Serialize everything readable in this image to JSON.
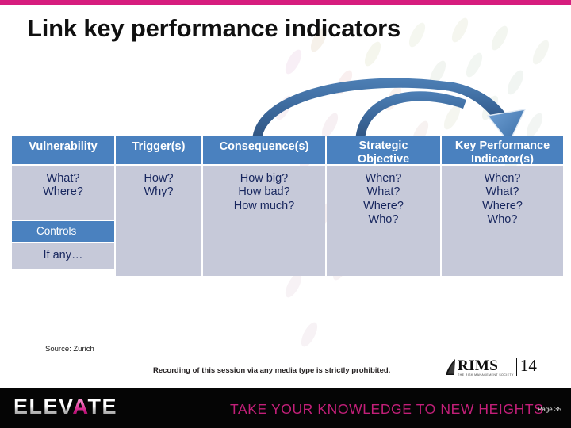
{
  "slide": {
    "title": "Link key performance indicators",
    "accent_magenta": "#d61d7e",
    "header_blue": "#4a81bf",
    "body_lavender": "#c6c9d9",
    "body_text_navy": "#17265e"
  },
  "diagram": {
    "arrow_color": "#3f6fa8",
    "arrow_1_label": "arc from Consequence(s) to Key Performance Indicator(s)",
    "arrow_2_label": "arc from Strategic Objective to Key Performance Indicator(s)"
  },
  "table": {
    "headers": [
      "Vulnerability",
      "Trigger(s)",
      "Consequence(s)",
      "Strategic Objective",
      "Key Performance Indicator(s)"
    ],
    "header_lines": [
      [
        "Vulnerability"
      ],
      [
        "Trigger(s)"
      ],
      [
        "Consequence(s)"
      ],
      [
        "Strategic",
        "Objective"
      ],
      [
        "Key Performance",
        "Indicator(s)"
      ]
    ],
    "row_main": [
      [
        "What?",
        "Where?"
      ],
      [
        "How?",
        "Why?"
      ],
      [
        "How big?",
        "How bad?",
        "How much?"
      ],
      [
        "When?",
        "What?",
        "Where?",
        "Who?"
      ],
      [
        "When?",
        "What?",
        "Where?",
        "Who?"
      ]
    ],
    "controls_label": "Controls",
    "controls_note": "If any…"
  },
  "footnotes": {
    "source": "Source: Zurich",
    "recording_notice": "Recording of this session via any media type is strictly prohibited."
  },
  "rims": {
    "word": "RIMS",
    "tagline": "THE RISK MANAGEMENT SOCIETY",
    "year": "14"
  },
  "footer": {
    "brand_prefix": "ELEV",
    "brand_apex": "A",
    "brand_suffix": "TE",
    "tagline": "TAKE YOUR KNOWLEDGE TO NEW HEIGHTS",
    "page_number": "Page 35"
  }
}
